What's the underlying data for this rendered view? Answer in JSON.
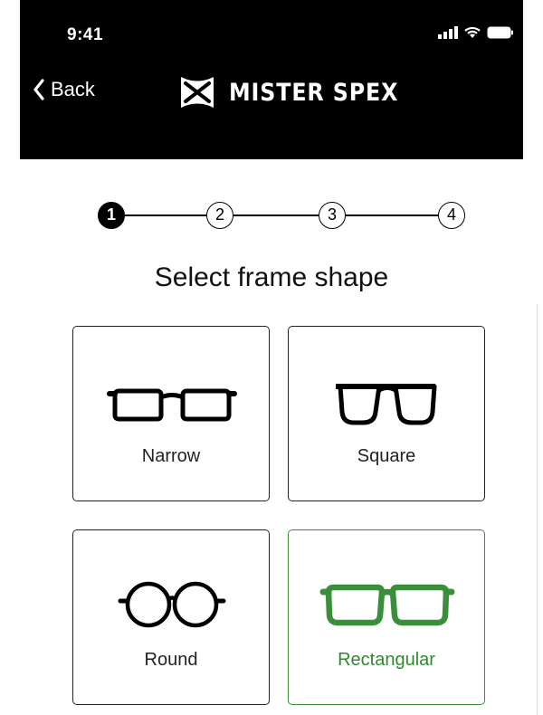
{
  "status": {
    "time": "9:41"
  },
  "header": {
    "back_label": "Back",
    "brand": "MISTER SPEX"
  },
  "stepper": {
    "steps": [
      "1",
      "2",
      "3",
      "4"
    ],
    "active": 1
  },
  "page": {
    "title": "Select frame shape"
  },
  "shapes": [
    {
      "label": "Narrow",
      "icon": "narrow-glasses-icon",
      "selected": false
    },
    {
      "label": "Square",
      "icon": "square-glasses-icon",
      "selected": false
    },
    {
      "label": "Round",
      "icon": "round-glasses-icon",
      "selected": false
    },
    {
      "label": "Rectangular",
      "icon": "rectangular-glasses-icon",
      "selected": true
    }
  ],
  "colors": {
    "header_bg": "#000000",
    "selected_accent": "#3a8f3a",
    "text": "#222222"
  }
}
